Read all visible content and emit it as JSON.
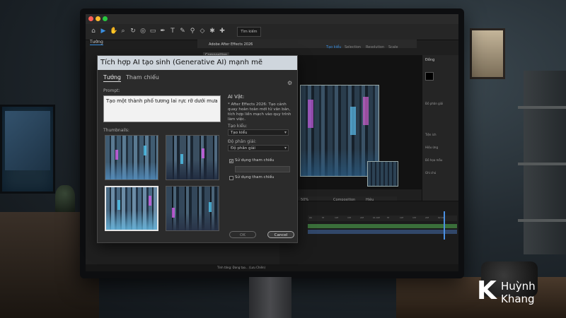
{
  "app": {
    "title": "Adobe After Effects 2026",
    "panel_tab": "Tướng",
    "comp_tab": "Composition",
    "search_field": "Tìm kiếm",
    "workspace_tabs": [
      "Tạo kiểu",
      "Selection",
      "Resolution",
      "Scale"
    ],
    "comp_footer": {
      "zoom": "50%",
      "preset": "Composition",
      "view": "Hiệu"
    },
    "timeline_ticks": [
      "00",
      "5f",
      "10f",
      "15f",
      "20f",
      "01:00f",
      "5f",
      "10f",
      "15f",
      "20f",
      "02:00f"
    ],
    "status": "Tính tăng: Đang tạo... (Lưu Chiến)"
  },
  "right_panel": {
    "title": "Đồng",
    "align_label": "Đồ phân giải",
    "items": [
      "Tiện ích",
      "Hiệu ứng",
      "Đồ họa mẫu",
      "Ghi chú"
    ]
  },
  "dialog": {
    "title": "Tích hợp AI tạo sinh (Generative AI) mạnh mẽ",
    "tabs": [
      "Tướng",
      "Tham chiếu"
    ],
    "active_tab": "Tướng",
    "prompt_label": "Prompt:",
    "prompt_value": "Tạo một thành phố tương lai rực rỡ dưới mưa",
    "thumbnails_label": "Thumbnails:",
    "thumbnails": [
      {
        "name": "thumbnail-1",
        "selected": false
      },
      {
        "name": "thumbnail-2",
        "selected": false
      },
      {
        "name": "thumbnail-3",
        "selected": true
      },
      {
        "name": "thumbnail-4",
        "selected": false
      }
    ],
    "side": {
      "title": "AI Vật:",
      "description": "* After Effects 2026: Tạo cảnh quay hoàn toàn mới từ văn bản, tích hợp liền mạch vào quy trình làm việc.",
      "style_label": "Tạo kiểu:",
      "style_value": "Tạo kiểu",
      "resolution_label": "Độ phân giải:",
      "resolution_value": "Độ phân giải",
      "ref1_label": "Sử dụng tham chiếu",
      "ref1_checked": true,
      "ref2_label": "Sử dụng tham chiếu",
      "ref2_checked": false
    },
    "ok_label": "OK",
    "cancel_label": "Cancel"
  },
  "logo": {
    "mark": "K",
    "line1": "Huỳnh",
    "line2": "Khang"
  },
  "colors": {
    "accent": "#3a8fe0",
    "dialog_header": "#cfd6dd",
    "dialog_body": "#2b2b2b",
    "neon_purple": "#d25fe8",
    "neon_cyan": "#4fc4ee"
  }
}
